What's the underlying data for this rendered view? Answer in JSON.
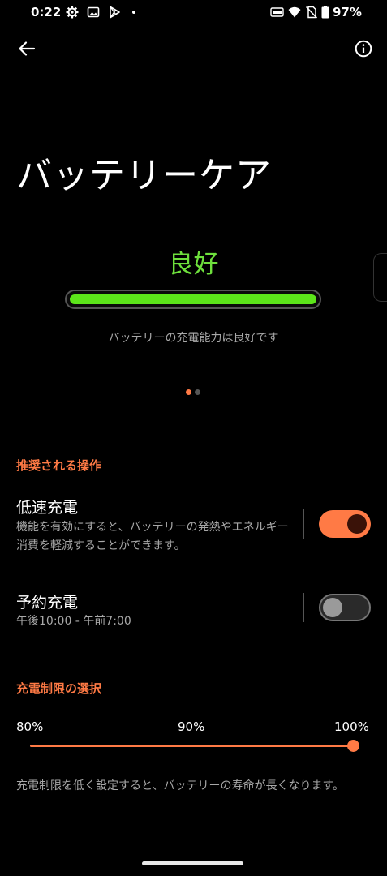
{
  "status_bar": {
    "time": "0:22",
    "battery_percent": "97%",
    "left_icons": [
      "gear-icon",
      "image-icon",
      "play-store-icon"
    ],
    "right_icons": [
      "data-saver-icon",
      "wifi-icon",
      "no-sim-icon",
      "battery-icon"
    ]
  },
  "header": {
    "title": "バッテリーケア"
  },
  "health": {
    "status": "良好",
    "description": "バッテリーの充電能力は良好です",
    "level": 1.0,
    "color": "#5ce51a"
  },
  "pager": {
    "count": 2,
    "active_index": 0
  },
  "recommended": {
    "header": "推奨される操作",
    "items": [
      {
        "title": "低速充電",
        "description": "機能を有効にすると、バッテリーの発熱やエネルギー消費を軽減することができます。",
        "enabled": true
      },
      {
        "title": "予約充電",
        "description": "午後10:00 - 午前7:00",
        "enabled": false
      }
    ]
  },
  "charge_limit": {
    "header": "充電制限の選択",
    "labels": [
      "80%",
      "90%",
      "100%"
    ],
    "selected": "100%",
    "selected_fraction": 1.0,
    "description": "充電制限を低く設定すると、バッテリーの寿命が長くなります。"
  },
  "colors": {
    "accent": "#ff7a45",
    "good": "#6ee03c",
    "background": "#000000"
  }
}
